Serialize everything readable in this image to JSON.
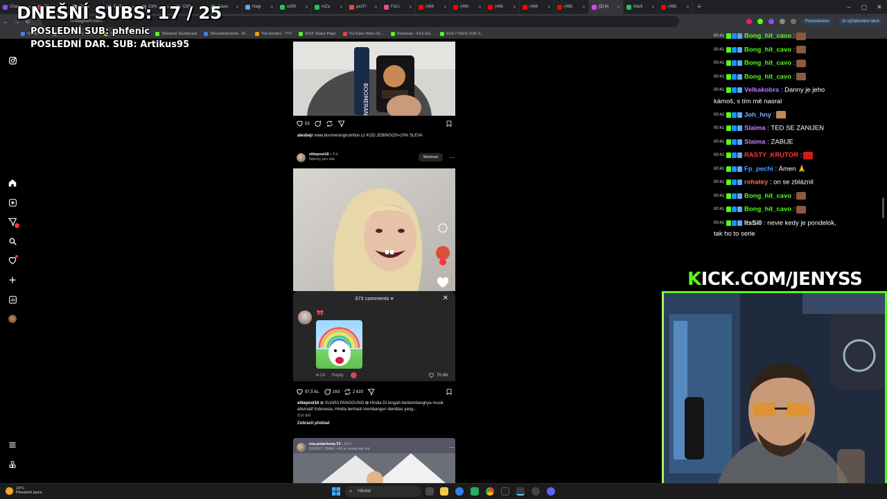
{
  "browser": {
    "tabs": [
      {
        "label": "Chat",
        "color": "#8f44ff"
      },
      {
        "label": "Str",
        "color": "#e53935"
      },
      {
        "label": "Strea",
        "color": "#bbbbbb"
      },
      {
        "label": "Betfi",
        "color": "#3b82f6"
      },
      {
        "label": "Ctrfv",
        "color": "#6b7280"
      },
      {
        "label": "Ctrfv",
        "color": "#6b7280"
      },
      {
        "label": "Kawa",
        "color": "#22c55e"
      },
      {
        "label": "Nagr",
        "color": "#60a5fa"
      },
      {
        "label": "w3W",
        "color": "#22c55e"
      },
      {
        "label": "mZa",
        "color": "#22c55e"
      },
      {
        "label": "pezFl",
        "color": "#ef4444"
      },
      {
        "label": "FizLi",
        "color": "#ec4899"
      },
      {
        "label": "(466",
        "color": "#ff0000"
      },
      {
        "label": "(466",
        "color": "#ff0000"
      },
      {
        "label": "(466",
        "color": "#ff0000"
      },
      {
        "label": "(466",
        "color": "#ff0000"
      },
      {
        "label": "(466",
        "color": "#ff0000"
      },
      {
        "label": "(2) In",
        "color": "#d946ef",
        "active": true
      },
      {
        "label": "Marti",
        "color": "#22c55e"
      },
      {
        "label": "(466",
        "color": "#ff0000"
      }
    ],
    "url": "instagram.com",
    "profile_label": "Pozastaveno",
    "update_label": "Je vyžadováno akce",
    "bookmarks": [
      {
        "label": "Vyúčtování",
        "color": "#3b82f6"
      },
      {
        "label": "File Converter - Free...",
        "color": "#6366f1"
      },
      {
        "label": "The best ChatBot an...",
        "color": "#eab308"
      },
      {
        "label": "Streamer Dashboard",
        "color": "#53fc18"
      },
      {
        "label": "StreamElements - M...",
        "color": "#3b82f6"
      },
      {
        "label": "Top Emotes - 7TV",
        "color": "#f59e0b"
      },
      {
        "label": "KICK Status Page",
        "color": "#53fc18"
      },
      {
        "label": "YouTube Video Do...",
        "color": "#ef4444"
      },
      {
        "label": "Kickaway - Kick Giv...",
        "color": "#53fc18"
      },
      {
        "label": "Kick / Twitch VOD d...",
        "color": "#53fc18"
      }
    ]
  },
  "overlay": {
    "subs": "DNEŠNÍ SUBS: 17 / 25",
    "last_sub": "POSLEDNÍ SUB: phfenic",
    "last_gift": "POSLEDNÍ DAR. SUB: Artikus95"
  },
  "feed": {
    "post1": {
      "likes": "53",
      "caption_user": "alesbejr",
      "caption_text": " www.boomerangnutrition.cz KOD JEBINGOS=10% SLEVA"
    },
    "post2": {
      "username": "elitepost16",
      "time": " • 3 d",
      "subtitle": "Návrhy pro vás",
      "follow_label": "Sledovat",
      "comments_title": "373 comments",
      "comment_date": "4-24",
      "reply_label": "Reply",
      "comment_likes": "70.8K",
      "likes": "97,5 tis.",
      "comments": "163",
      "reposts": "2 620",
      "caption_user": "elitepost16",
      "caption_text": " ⊠ SUARA PANGGUNG ⊠ Hindia Di tengah berkembangnya musik alternatif Indonesia, Hindia berhasil membangun identitas yang...",
      "more_label": "číst dál",
      "translate_label": "Zobrazit překlad"
    },
    "post3": {
      "username": "eva.polackova.73",
      "time": " • 14 h",
      "subtitle": "SONGY JINAK • Až je nevka tak lek"
    }
  },
  "chat": [
    {
      "time": "00:41",
      "user": "Bong_hit_cavo",
      "color": "#53fc18",
      "text": " :",
      "emote": "#8b5a3c"
    },
    {
      "time": "00:41",
      "user": "Bong_hit_cavo",
      "color": "#53fc18",
      "text": " :",
      "emote": "#8b5a3c"
    },
    {
      "time": "00:41",
      "user": "Bong_hit_cavo",
      "color": "#53fc18",
      "text": " :",
      "emote": "#8b5a3c"
    },
    {
      "time": "00:41",
      "user": "Bong_hit_cavo",
      "color": "#53fc18",
      "text": " :",
      "emote": "#8b5a3c"
    },
    {
      "time": "00:41",
      "user": "Velkakobra",
      "color": "#b57cff",
      "text": " : Danny je jeho",
      "cont": "kámoš, s tím mě nasral"
    },
    {
      "time": "00:41",
      "user": "Joh_hny",
      "color": "#7fb2ff",
      "text": " :",
      "emote": "#c08a5a"
    },
    {
      "time": "00:41",
      "user": "Slaima",
      "color": "#c77dff",
      "text": " : TED SE ZANIJEN"
    },
    {
      "time": "00:41",
      "user": "Slaima",
      "color": "#c77dff",
      "text": " : ZABIJE"
    },
    {
      "time": "00:41",
      "user": "RASTY_KRUTOR",
      "color": "#ff3b3b",
      "text": " :",
      "emote": "#d01a1a"
    },
    {
      "time": "00:41",
      "user": "Fp_pechi",
      "color": "#4aa3ff",
      "text": " : Ámen 🙏"
    },
    {
      "time": "00:41",
      "user": "rohatey",
      "color": "#ff6f3c",
      "text": " : on se zbláznil"
    },
    {
      "time": "00:41",
      "user": "Bong_hit_cavo",
      "color": "#53fc18",
      "text": " :",
      "emote": "#8b5a3c"
    },
    {
      "time": "00:41",
      "user": "Bong_hit_cavo",
      "color": "#53fc18",
      "text": " :",
      "emote": "#8b5a3c"
    },
    {
      "time": "00:41",
      "user": "ItsSi0",
      "color": "#ffffff",
      "text": " : nevie kedy je pondelok,",
      "cont": "tak ho to serie"
    }
  ],
  "kick": {
    "prefix": "K",
    "rest": "ICK.COM/JENYSS",
    "brand_color": "#53fc18"
  },
  "taskbar": {
    "temp": "14°C",
    "weather": "Převážně jasno",
    "search_placeholder": "Hledat"
  }
}
